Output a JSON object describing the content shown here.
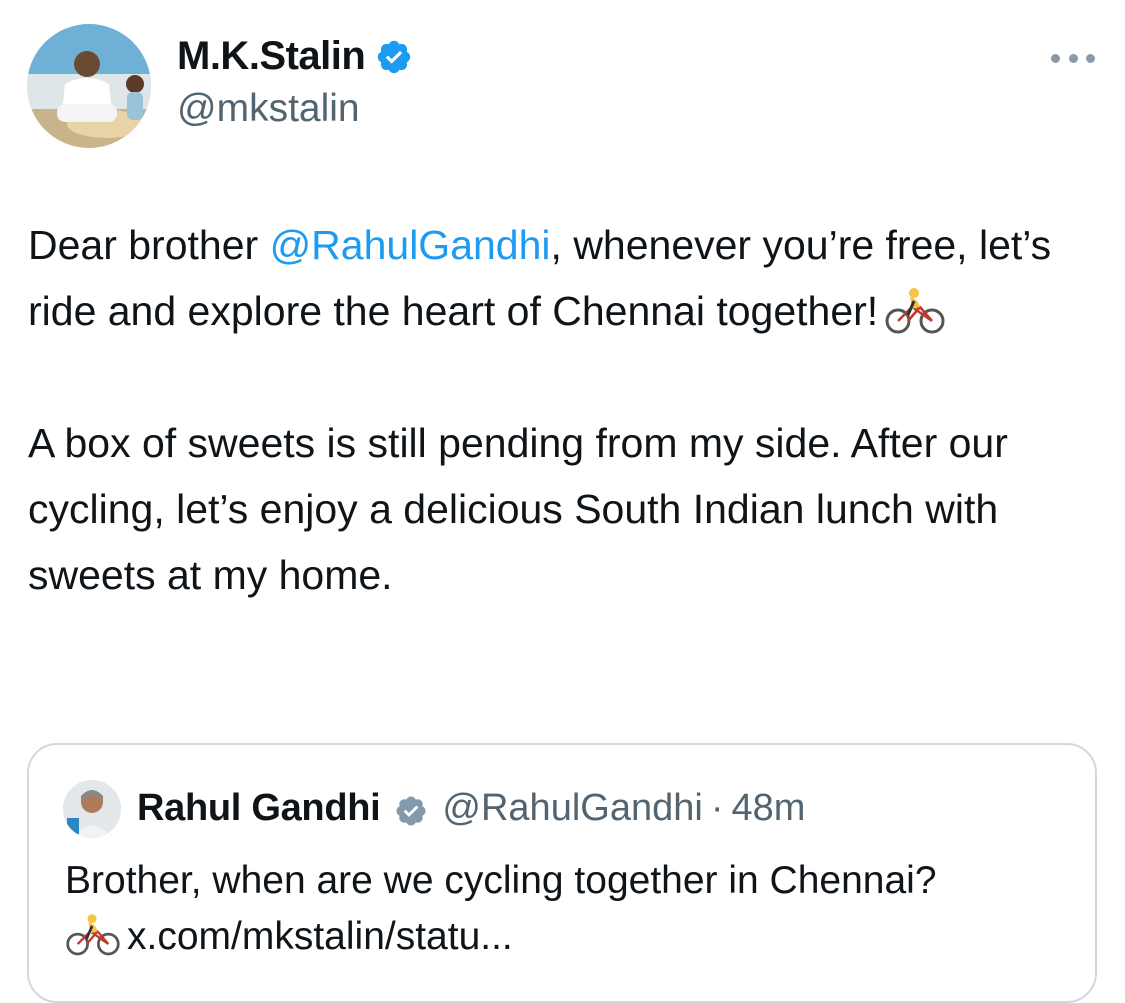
{
  "author": {
    "name": "M.K.Stalin",
    "handle": "@mkstalin",
    "avatar_icon": "profile-photo",
    "verified_icon": "verified-badge-icon"
  },
  "more_icon": "more-options-icon",
  "tweet": {
    "p1_pre": "Dear brother ",
    "p1_mention": "@RahulGandhi",
    "p1_post": ", whenever you’re free, let’s ride and explore the heart of Chennai together!",
    "p1_emoji": "bicyclist-emoji",
    "p2": "A box of sweets is still pending from my side. After our cycling, let’s enjoy a delicious South Indian lunch with sweets at my home."
  },
  "quote": {
    "name": "Rahul Gandhi",
    "handle": "@RahulGandhi",
    "separator": "·",
    "time": "48m",
    "text": "Brother, when are we cycling together in Chennai?",
    "emoji": "bicyclist-emoji",
    "link": "x.com/mkstalin/statu..."
  },
  "colors": {
    "link": "#1d9bf0",
    "verified_blue": "#1d9bf0",
    "verified_grey": "#829aab",
    "secondary_text": "#536471",
    "border": "#cfd9de"
  }
}
